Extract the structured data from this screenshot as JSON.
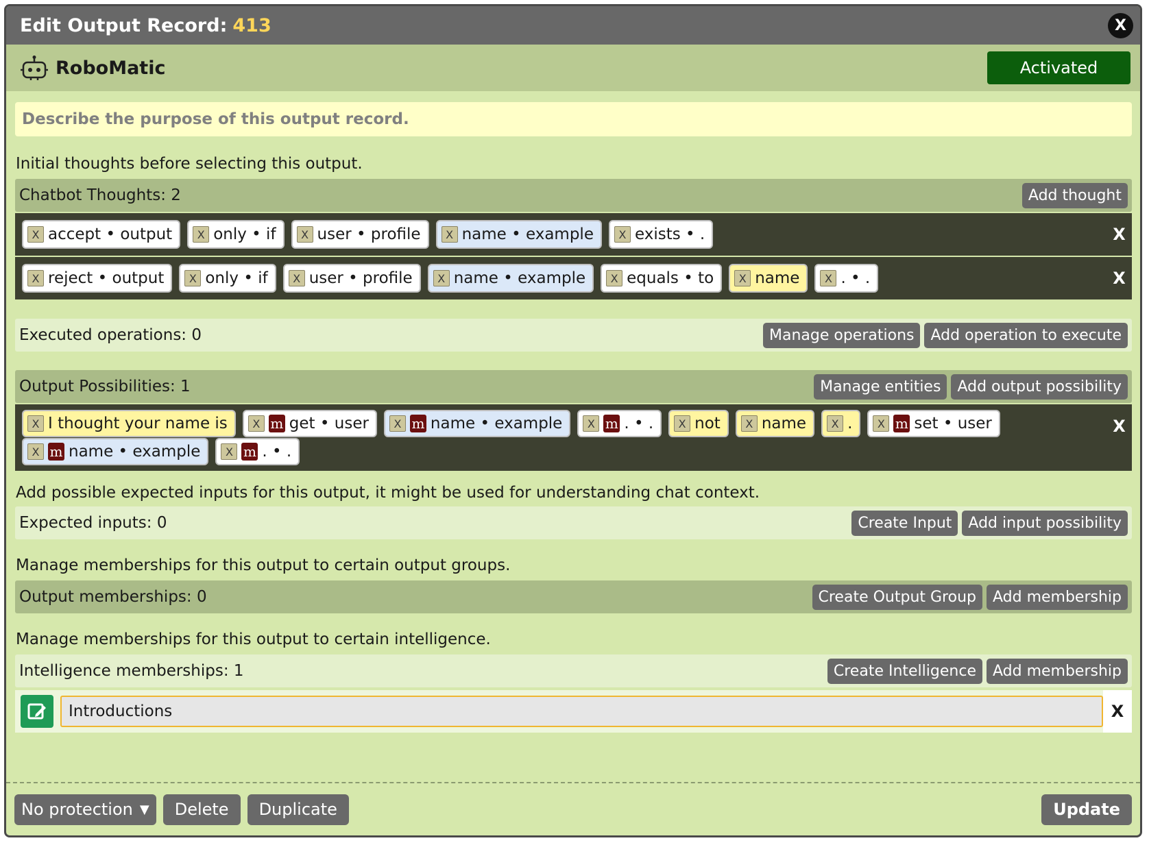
{
  "title": {
    "prefix": "Edit Output Record:",
    "record_id": "413",
    "close": "X"
  },
  "bot": {
    "name": "RoboMatic",
    "status": "Activated"
  },
  "purpose_placeholder": "Describe the purpose of this output record.",
  "thoughts_note": "Initial thoughts before selecting this output.",
  "thoughts": {
    "label": "Chatbot Thoughts: 2",
    "add_button": "Add thought",
    "rows": [
      {
        "tokens": [
          {
            "text": "accept • output",
            "style": "white"
          },
          {
            "text": "only • if",
            "style": "white"
          },
          {
            "text": "user • profile",
            "style": "white"
          },
          {
            "text": "name • example",
            "style": "blue"
          },
          {
            "text": "exists • .",
            "style": "white"
          }
        ]
      },
      {
        "tokens": [
          {
            "text": "reject • output",
            "style": "white"
          },
          {
            "text": "only • if",
            "style": "white"
          },
          {
            "text": "user • profile",
            "style": "white"
          },
          {
            "text": "name • example",
            "style": "blue"
          },
          {
            "text": "equals • to",
            "style": "white"
          },
          {
            "text": "name",
            "style": "yellow"
          },
          {
            "text": ". • .",
            "style": "white"
          }
        ]
      }
    ]
  },
  "operations": {
    "label": "Executed operations: 0",
    "manage_button": "Manage operations",
    "add_button": "Add operation to execute"
  },
  "outputs": {
    "label": "Output Possibilities: 1",
    "manage_button": "Manage entities",
    "add_button": "Add output possibility",
    "tokens": [
      {
        "text": "I thought your name is",
        "style": "yellow",
        "m": false
      },
      {
        "text": "get • user",
        "style": "white",
        "m": true
      },
      {
        "text": "name • example",
        "style": "blue",
        "m": true
      },
      {
        "text": ". • .",
        "style": "white",
        "m": true
      },
      {
        "text": " not",
        "style": "yellow",
        "m": false
      },
      {
        "text": "name",
        "style": "yellow",
        "m": false
      },
      {
        "text": ".",
        "style": "yellow",
        "m": false
      },
      {
        "text": "set • user",
        "style": "white",
        "m": true
      },
      {
        "text": "name • example",
        "style": "blue",
        "m": true
      },
      {
        "text": ". • .",
        "style": "white",
        "m": true
      }
    ],
    "m_glyph": "m",
    "x_glyph": "X"
  },
  "inputs_note": "Add possible expected inputs for this output, it might be used for understanding chat context.",
  "inputs": {
    "label": "Expected inputs: 0",
    "create_button": "Create Input",
    "add_button": "Add input possibility"
  },
  "memberships_note": "Manage memberships for this output to certain output groups.",
  "memberships": {
    "label": "Output memberships: 0",
    "create_button": "Create Output Group",
    "add_button": "Add membership"
  },
  "intelligence_note": "Manage memberships for this output to certain intelligence.",
  "intelligence": {
    "label": "Intelligence memberships: 1",
    "create_button": "Create Intelligence",
    "add_button": "Add membership",
    "value": "Introductions",
    "remove": "X"
  },
  "footer": {
    "protection": "No protection",
    "delete": "Delete",
    "duplicate": "Duplicate",
    "update": "Update"
  },
  "colors": {
    "accent_green": "#0c5e0c",
    "record_id": "#ffd659",
    "token_blue": "#dbe8f8",
    "token_yellow": "#fff5a0",
    "m_badge": "#6b0f0f"
  }
}
